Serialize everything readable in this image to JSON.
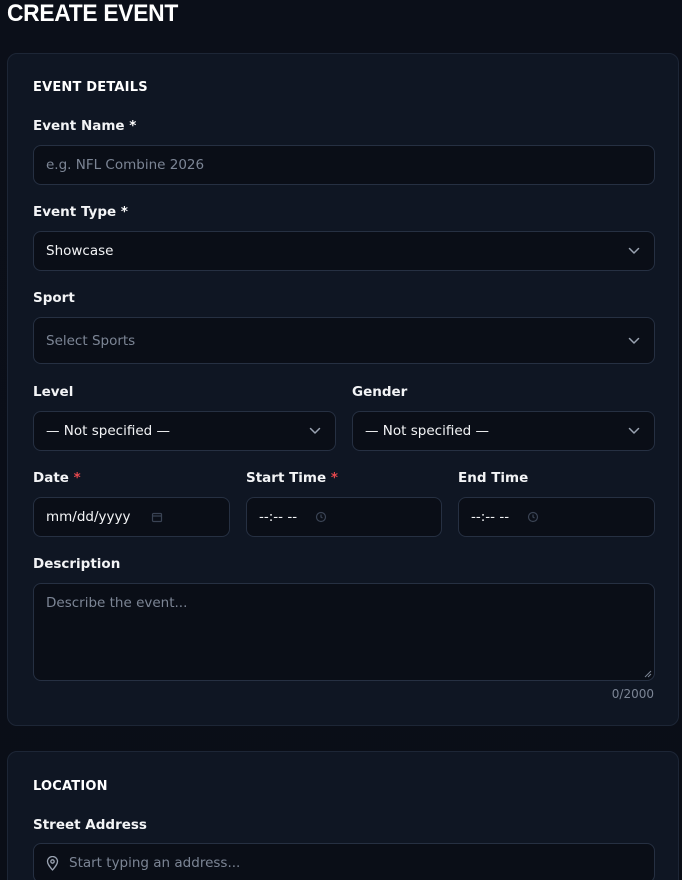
{
  "page": {
    "title": "CREATE EVENT"
  },
  "event_details": {
    "section_title": "EVENT DETAILS",
    "event_name": {
      "label": "Event Name",
      "required_mark": "*",
      "placeholder": "e.g. NFL Combine 2026"
    },
    "event_type": {
      "label": "Event Type",
      "required_mark": "*",
      "value": "Showcase"
    },
    "sport": {
      "label": "Sport",
      "placeholder": "Select Sports"
    },
    "level": {
      "label": "Level",
      "value": "— Not specified —"
    },
    "gender": {
      "label": "Gender",
      "value": "— Not specified —"
    },
    "date": {
      "label": "Date",
      "required_mark": "*",
      "placeholder": "mm/dd/yyyy"
    },
    "start_time": {
      "label": "Start Time",
      "required_mark": "*",
      "placeholder": "--:-- --"
    },
    "end_time": {
      "label": "End Time",
      "placeholder": "--:-- --"
    },
    "description": {
      "label": "Description",
      "placeholder": "Describe the event...",
      "counter": "0/2000"
    }
  },
  "location": {
    "section_title": "LOCATION",
    "street_address": {
      "label": "Street Address",
      "placeholder": "Start typing an address..."
    }
  },
  "icons": {
    "chevron": "chevron-down-icon",
    "calendar": "calendar-icon",
    "clock": "clock-icon",
    "location_pin": "location-pin-icon"
  },
  "colors": {
    "background": "#0a0e17",
    "card": "#0f1623",
    "border": "#263042",
    "required": "#e5484d",
    "placeholder": "#7c8595"
  }
}
